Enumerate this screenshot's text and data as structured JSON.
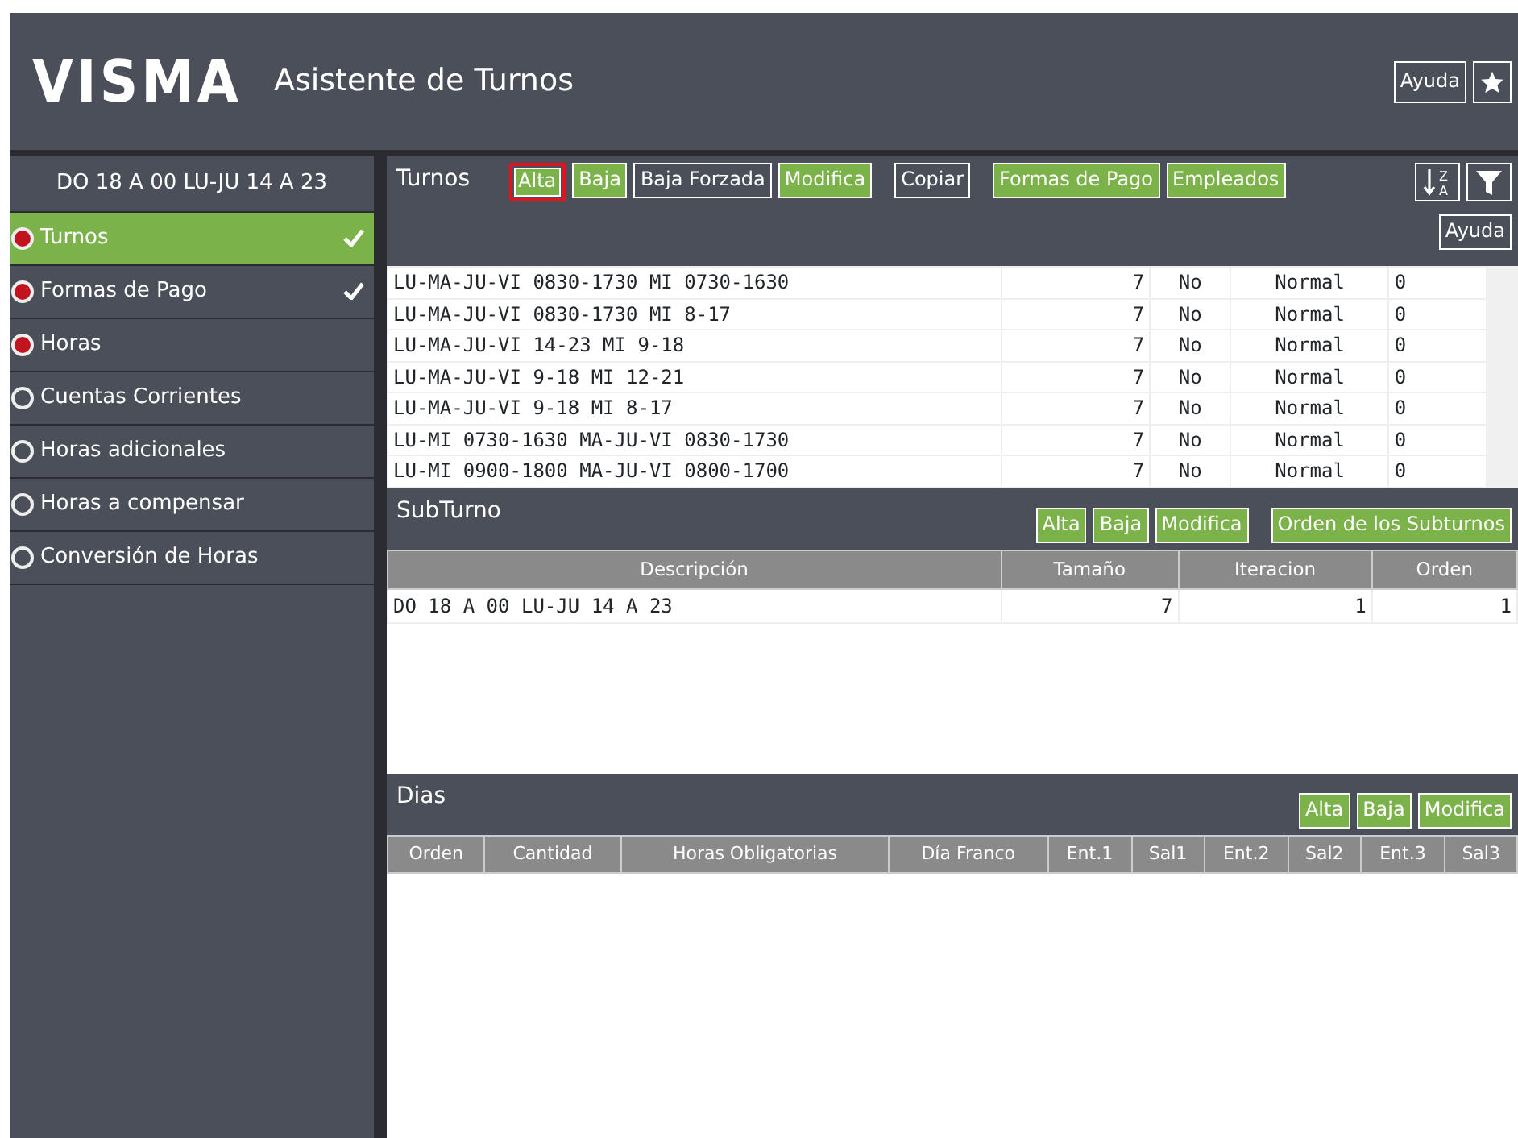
{
  "header": {
    "logo": "VISMA",
    "title": "Asistente de Turnos",
    "help": "Ayuda"
  },
  "sidebar": {
    "title": "DO 18 A 00 LU-JU 14 A 23",
    "items": [
      {
        "label": "Turnos",
        "selected": true,
        "filled": true,
        "checked": true
      },
      {
        "label": "Formas de Pago",
        "selected": false,
        "filled": true,
        "checked": true
      },
      {
        "label": "Horas",
        "selected": false,
        "filled": true,
        "checked": false
      },
      {
        "label": "Cuentas Corrientes",
        "selected": false,
        "filled": false,
        "checked": false
      },
      {
        "label": "Horas adicionales",
        "selected": false,
        "filled": false,
        "checked": false
      },
      {
        "label": "Horas a compensar",
        "selected": false,
        "filled": false,
        "checked": false
      },
      {
        "label": "Conversión de Horas",
        "selected": false,
        "filled": false,
        "checked": false
      }
    ]
  },
  "turnos": {
    "title": "Turnos",
    "help": "Ayuda",
    "sort_letters": [
      "Z",
      "A"
    ],
    "buttons": [
      {
        "label": "Alta",
        "kind": "action",
        "focused": true
      },
      {
        "label": "Baja",
        "kind": "action",
        "focused": false
      },
      {
        "label": "Baja Forzada",
        "kind": "plain",
        "focused": false
      },
      {
        "label": "Modifica",
        "kind": "action",
        "focused": false
      },
      {
        "label": "Copiar",
        "kind": "plain",
        "focused": false
      },
      {
        "label": "Formas de Pago",
        "kind": "action",
        "focused": false
      },
      {
        "label": "Empleados",
        "kind": "action",
        "focused": false
      }
    ],
    "rows": [
      [
        "LU-MA-JU-VI 0830-1730 MI 0730-1630",
        "7",
        "No",
        "Normal",
        "0"
      ],
      [
        "LU-MA-JU-VI 0830-1730 MI 8-17",
        "7",
        "No",
        "Normal",
        "0"
      ],
      [
        "LU-MA-JU-VI 14-23 MI 9-18",
        "7",
        "No",
        "Normal",
        "0"
      ],
      [
        "LU-MA-JU-VI 9-18 MI 12-21",
        "7",
        "No",
        "Normal",
        "0"
      ],
      [
        "LU-MA-JU-VI 9-18 MI 8-17",
        "7",
        "No",
        "Normal",
        "0"
      ],
      [
        "LU-MI 0730-1630 MA-JU-VI 0830-1730",
        "7",
        "No",
        "Normal",
        "0"
      ],
      [
        "LU-MI 0900-1800 MA-JU-VI 0800-1700",
        "7",
        "No",
        "Normal",
        "0"
      ]
    ]
  },
  "subturno": {
    "title": "SubTurno",
    "buttons": [
      {
        "label": "Alta",
        "kind": "action",
        "focused": false
      },
      {
        "label": "Baja",
        "kind": "action",
        "focused": false
      },
      {
        "label": "Modifica",
        "kind": "action",
        "focused": false
      },
      {
        "label": "Orden de los Subturnos",
        "kind": "action",
        "focused": false
      }
    ],
    "columns": [
      "Descripción",
      "Tamaño",
      "Iteracion",
      "Orden"
    ],
    "rows": [
      [
        "DO 18 A 00 LU-JU 14 A 23",
        "7",
        "1",
        "1"
      ]
    ]
  },
  "dias": {
    "title": "Dias",
    "buttons": [
      {
        "label": "Alta",
        "kind": "action",
        "focused": false
      },
      {
        "label": "Baja",
        "kind": "action",
        "focused": false
      },
      {
        "label": "Modifica",
        "kind": "action",
        "focused": false
      }
    ],
    "columns": [
      "Orden",
      "Cantidad",
      "Horas Obligatorias",
      "Día Franco",
      "Ent.1",
      "Sal1",
      "Ent.2",
      "Sal2",
      "Ent.3",
      "Sal3"
    ]
  }
}
